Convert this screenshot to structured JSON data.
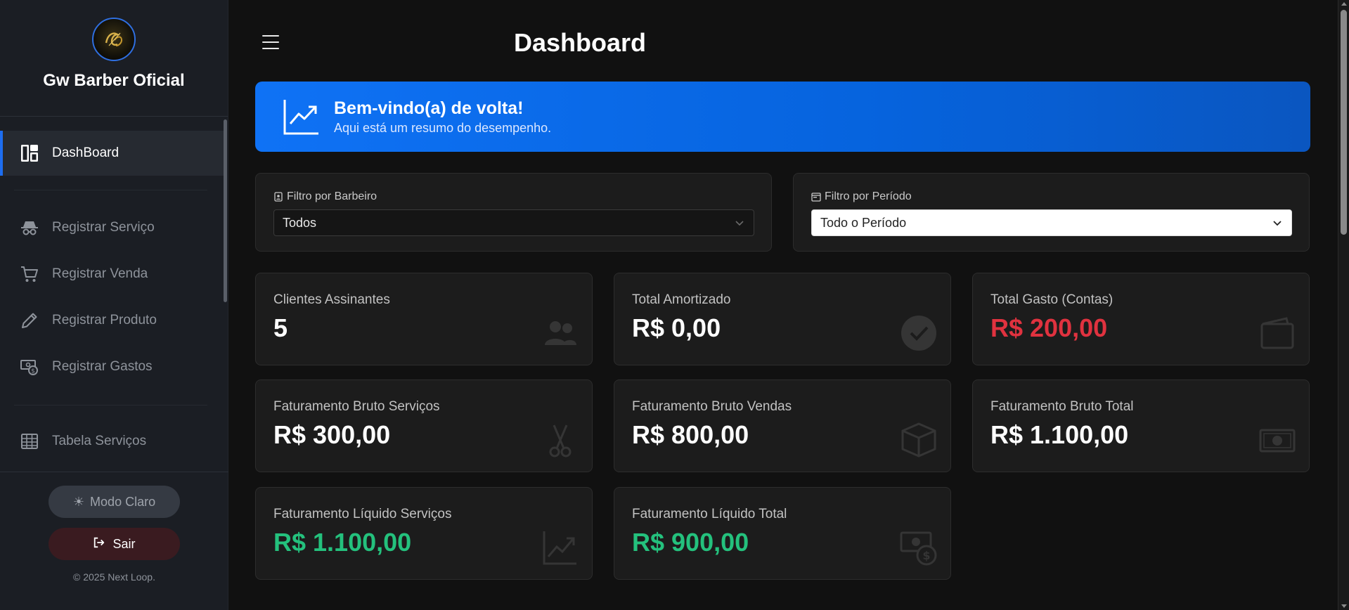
{
  "sidebar": {
    "brand_name": "Gw Barber Oficial",
    "logo_icon": "barber-logo",
    "items": [
      {
        "label": "DashBoard",
        "icon": "dashboard-icon",
        "active": true
      },
      {
        "label": "Registrar Serviço",
        "icon": "incognito-icon",
        "active": false
      },
      {
        "label": "Registrar Venda",
        "icon": "cart-icon",
        "active": false
      },
      {
        "label": "Registrar Produto",
        "icon": "pencil-icon",
        "active": false
      },
      {
        "label": "Registrar Gastos",
        "icon": "cash-coin-icon",
        "active": false
      },
      {
        "label": "Tabela Serviços",
        "icon": "table-icon",
        "active": false
      }
    ],
    "mode_button": "Modo Claro",
    "exit_button": "Sair",
    "copyright": "© 2025 Next Loop."
  },
  "header": {
    "title": "Dashboard"
  },
  "welcome": {
    "title": "Bem-vindo(a) de volta!",
    "subtitle": "Aqui está um resumo do desempenho."
  },
  "filters": {
    "barber": {
      "label": "Filtro por Barbeiro",
      "selected": "Todos"
    },
    "period": {
      "label": "Filtro por Período",
      "selected": "Todo o Período"
    }
  },
  "cards": [
    {
      "label": "Clientes Assinantes",
      "value": "5",
      "tone": "white",
      "icon": "people-icon"
    },
    {
      "label": "Total Amortizado",
      "value": "R$ 0,00",
      "tone": "white",
      "icon": "check-circle-icon"
    },
    {
      "label": "Total Gasto (Contas)",
      "value": "R$ 200,00",
      "tone": "red",
      "icon": "wallet-icon"
    },
    {
      "label": "Faturamento Bruto Serviços",
      "value": "R$ 300,00",
      "tone": "white",
      "icon": "scissors-icon"
    },
    {
      "label": "Faturamento Bruto Vendas",
      "value": "R$ 800,00",
      "tone": "white",
      "icon": "box-icon"
    },
    {
      "label": "Faturamento Bruto Total",
      "value": "R$ 1.100,00",
      "tone": "white",
      "icon": "cash-icon"
    },
    {
      "label": "Faturamento Líquido Serviços",
      "value": "R$ 1.100,00",
      "tone": "green",
      "icon": "graph-up-icon"
    },
    {
      "label": "Faturamento Líquido Total",
      "value": "R$ 900,00",
      "tone": "green",
      "icon": "cash-coin-icon"
    }
  ],
  "colors": {
    "accent": "#1d6df0",
    "red": "#e0323f",
    "green": "#24c17d",
    "sidebar_bg": "#1b1e24",
    "page_bg": "#111111"
  }
}
